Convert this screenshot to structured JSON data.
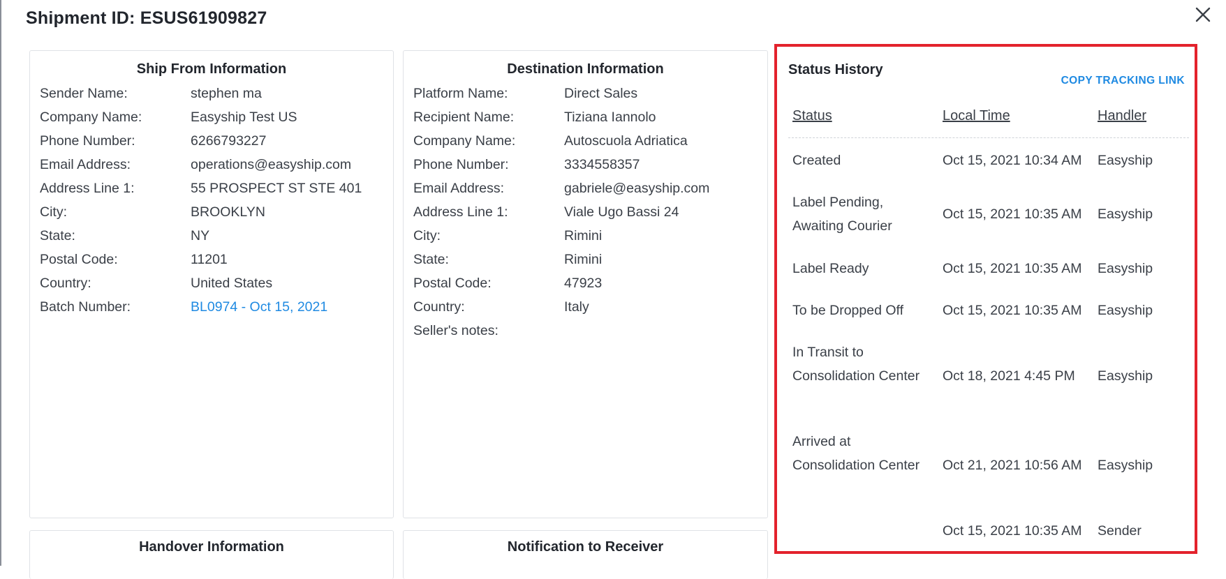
{
  "header": {
    "title": "Shipment ID: ESUS61909827"
  },
  "ship_from": {
    "title": "Ship From Information",
    "rows": [
      {
        "label": "Sender Name:",
        "value": "stephen ma"
      },
      {
        "label": "Company Name:",
        "value": "Easyship Test US"
      },
      {
        "label": "Phone Number:",
        "value": "6266793227"
      },
      {
        "label": "Email Address:",
        "value": "operations@easyship.com"
      },
      {
        "label": "Address Line 1:",
        "value": "55 PROSPECT ST STE 401"
      },
      {
        "label": "City:",
        "value": "BROOKLYN"
      },
      {
        "label": "State:",
        "value": "NY"
      },
      {
        "label": "Postal Code:",
        "value": "11201"
      },
      {
        "label": "Country:",
        "value": "United States"
      },
      {
        "label": "Batch Number:",
        "value": "BL0974 - Oct 15, 2021"
      }
    ]
  },
  "destination": {
    "title": "Destination Information",
    "rows": [
      {
        "label": "Platform Name:",
        "value": "Direct Sales"
      },
      {
        "label": "Recipient Name:",
        "value": "Tiziana Iannolo"
      },
      {
        "label": "Company Name:",
        "value": "Autoscuola Adriatica"
      },
      {
        "label": "Phone Number:",
        "value": "3334558357"
      },
      {
        "label": "Email Address:",
        "value": "gabriele@easyship.com"
      },
      {
        "label": "Address Line 1:",
        "value": "Viale Ugo Bassi 24"
      },
      {
        "label": "City:",
        "value": "Rimini"
      },
      {
        "label": "State:",
        "value": "Rimini"
      },
      {
        "label": "Postal Code:",
        "value": "47923"
      },
      {
        "label": "Country:",
        "value": "Italy"
      },
      {
        "label": "Seller's notes:",
        "value": ""
      }
    ]
  },
  "status_history": {
    "title": "Status History",
    "copy_link_label": "COPY TRACKING LINK",
    "columns": {
      "status": "Status",
      "local_time": "Local Time",
      "handler": "Handler"
    },
    "rows": [
      {
        "status": "Created",
        "time": "Oct 15, 2021 10:34 AM",
        "handler": "Easyship"
      },
      {
        "status": "Label Pending, Awaiting Courier",
        "time": "Oct 15, 2021 10:35 AM",
        "handler": "Easyship"
      },
      {
        "status": "Label Ready",
        "time": "Oct 15, 2021 10:35 AM",
        "handler": "Easyship"
      },
      {
        "status": "To be Dropped Off",
        "time": "Oct 15, 2021 10:35 AM",
        "handler": "Easyship"
      },
      {
        "status": "In Transit to Consolidation Center",
        "time": "Oct 18, 2021 4:45 PM",
        "handler": "Easyship"
      },
      {
        "status": "Arrived at Consolidation Center",
        "time": "Oct 21, 2021 10:56 AM",
        "handler": "Easyship"
      },
      {
        "status": "",
        "time": "Oct 15, 2021 10:35 AM",
        "handler": "Sender"
      }
    ]
  },
  "handover": {
    "title": "Handover Information"
  },
  "notification": {
    "title": "Notification to Receiver"
  },
  "colors": {
    "highlight_border": "#e3222c",
    "link": "#1f8ae2",
    "panel_border": "#dfe2e6"
  }
}
